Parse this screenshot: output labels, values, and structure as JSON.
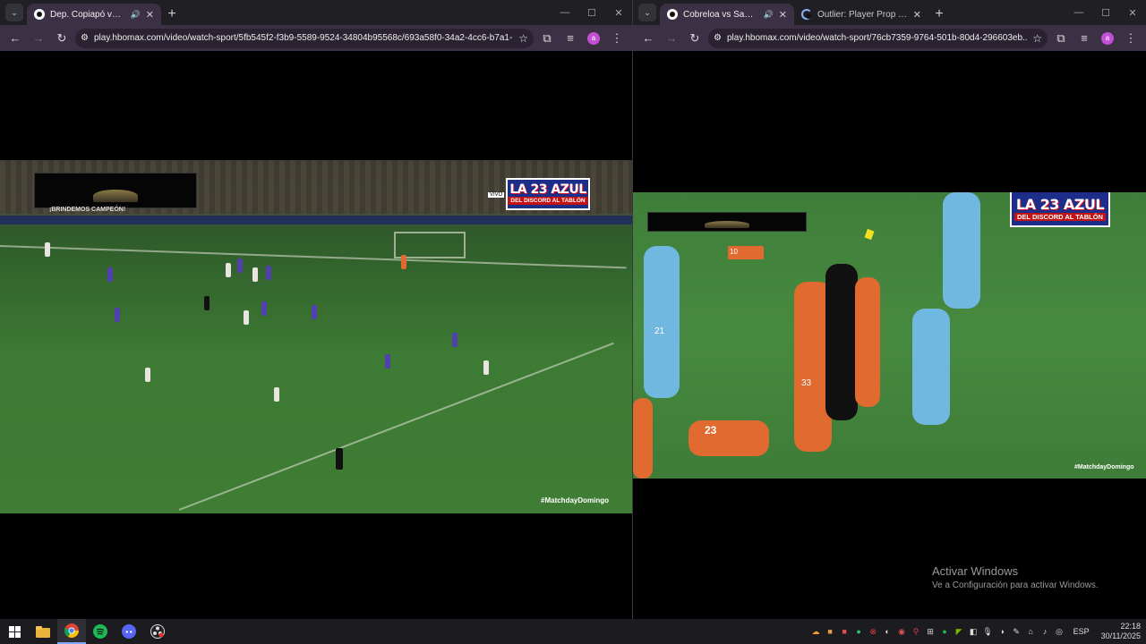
{
  "left_window": {
    "tabs": [
      {
        "title": "Dep. Copiapó vs Dep. Concepción",
        "active": true,
        "audio": "🔊"
      }
    ],
    "url": "play.hbomax.com/video/watch-sport/5fb545f2-f3b9-5589-9524-34804b95568c/693a58f0-34a2-4cc6-b7a1-1...",
    "avatar_letter": "a",
    "video": {
      "overlay_logo_line1": "LA 23 AZUL",
      "overlay_logo_line2": "DEL DISCORD AL TABLÓN",
      "banner_text": "¡BRINDEMOS CAMPEÓN!",
      "live_badge": "VIVO",
      "hashtag": "#MatchdayDomingo"
    }
  },
  "right_window": {
    "tabs": [
      {
        "title": "Cobreloa vs San Marcos • HBO Max",
        "active": true,
        "audio": "🔊"
      },
      {
        "title": "Outlier: Player Prop & Betting Tool",
        "active": false
      }
    ],
    "url": "play.hbomax.com/video/watch-sport/76cb7359-9764-501b-80d4-296603eb...",
    "avatar_letter": "a",
    "video": {
      "overlay_logo_line1": "LA 23 AZUL",
      "overlay_logo_line2": "DEL DISCORD AL TABLÓN",
      "hashtag": "#MatchdayDomingo",
      "jersey_numbers": [
        "21",
        "33",
        "23",
        "10"
      ]
    }
  },
  "watermark": {
    "title": "Activar Windows",
    "subtitle": "Ve a Configuración para activar Windows."
  },
  "taskbar": {
    "language": "ESP",
    "time": "22:18",
    "date": "30/11/2025"
  },
  "colors": {
    "tab_active": "#3b3044",
    "tabstrip": "#1f1f24",
    "taskbar": "#1c1c20",
    "logo_blue": "#1d2d8a",
    "logo_red": "#c21212"
  },
  "icons": [
    "tab-search-icon",
    "audio-icon",
    "close-icon",
    "new-tab-icon",
    "minimize-icon",
    "maximize-icon",
    "window-close-icon",
    "back-icon",
    "forward-icon",
    "reload-icon",
    "site-info-icon",
    "bookmark-star-icon",
    "extensions-icon",
    "media-control-icon",
    "menu-icon",
    "windows-start-icon",
    "file-explorer-icon",
    "chrome-icon",
    "spotify-icon",
    "discord-icon",
    "obs-icon"
  ]
}
